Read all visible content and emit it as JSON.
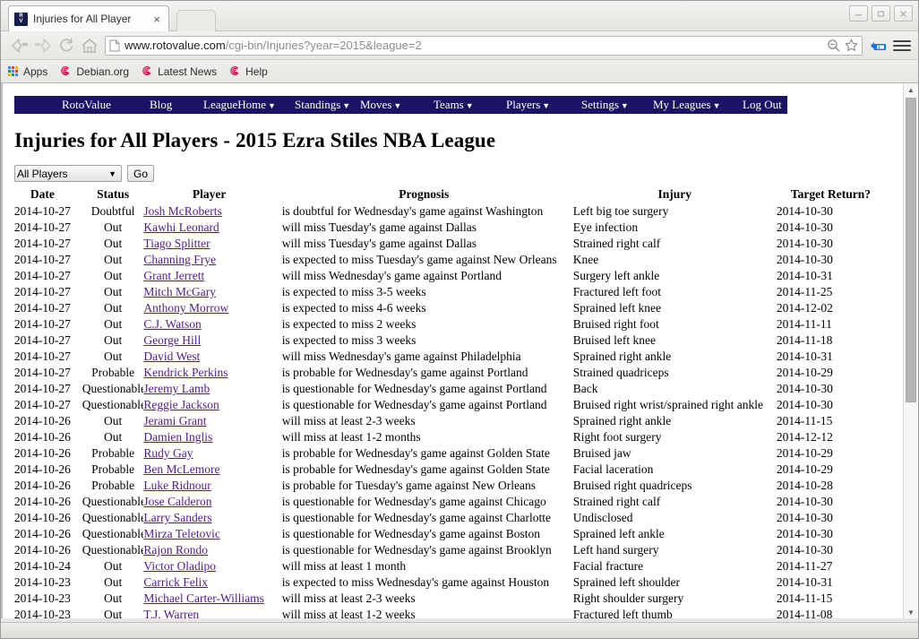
{
  "browser": {
    "tab": {
      "title": "Injuries for All Player",
      "favicon_text_top": "R",
      "favicon_text_bottom": "V",
      "close_label": "×"
    },
    "window_controls": {
      "minimize": "—",
      "maximize": "❐",
      "close": "✕"
    },
    "toolbar": {
      "back_icon": "back-arrow-icon",
      "forward_icon": "forward-arrow-icon",
      "reload_icon": "reload-icon",
      "home_icon": "home-icon",
      "url_host": "www.rotovalue.com",
      "url_path": "/cgi-bin/Injuries?year=2015&league=2",
      "search_icon": "search-icon",
      "bookmark_icon": "star-icon",
      "extension_icon": "extension-icon",
      "menu_icon": "hamburger-menu-icon"
    },
    "bookmarks": [
      {
        "label": "Apps",
        "icon": "apps-grid-icon"
      },
      {
        "label": "Debian.org",
        "icon": "debian-swirl-icon"
      },
      {
        "label": "Latest News",
        "icon": "debian-swirl-icon"
      },
      {
        "label": "Help",
        "icon": "debian-swirl-icon"
      }
    ]
  },
  "site": {
    "nav": [
      {
        "label": "RotoValue",
        "caret": ""
      },
      {
        "label": "Blog",
        "caret": ""
      },
      {
        "label": "LeagueHome",
        "caret": "▼"
      },
      {
        "label": "Standings",
        "caret": "▼"
      },
      {
        "label": "Moves",
        "caret": "▼"
      },
      {
        "label": "Teams",
        "caret": "▼"
      },
      {
        "label": "Players",
        "caret": "▼"
      },
      {
        "label": "Settings",
        "caret": "▼"
      },
      {
        "label": "My Leagues",
        "caret": "▼"
      },
      {
        "label": "Log Out",
        "caret": ""
      }
    ],
    "nav_background": "#1b1464",
    "page_title": "Injuries for All Players - 2015 Ezra Stiles NBA League",
    "filter": {
      "select_value": "All Players",
      "select_caret": "▼",
      "go_label": "Go"
    },
    "table": {
      "headers": [
        "Date",
        "Status",
        "Player",
        "Prognosis",
        "Injury",
        "Target Return?"
      ],
      "link_color": "#551a8b",
      "rows": [
        [
          "2014-10-27",
          "Doubtful",
          "Josh McRoberts",
          "is doubtful for Wednesday's game against Washington",
          "Left big toe surgery",
          "2014-10-30"
        ],
        [
          "2014-10-27",
          "Out",
          "Kawhi Leonard",
          "will miss Tuesday's game against Dallas",
          "Eye infection",
          "2014-10-30"
        ],
        [
          "2014-10-27",
          "Out",
          "Tiago Splitter",
          "will miss Tuesday's game against Dallas",
          "Strained right calf",
          "2014-10-30"
        ],
        [
          "2014-10-27",
          "Out",
          "Channing Frye",
          "is expected to miss Tuesday's game against New Orleans",
          "Knee",
          "2014-10-30"
        ],
        [
          "2014-10-27",
          "Out",
          "Grant Jerrett",
          "will miss Wednesday's game against Portland",
          "Surgery left ankle",
          "2014-10-31"
        ],
        [
          "2014-10-27",
          "Out",
          "Mitch McGary",
          "is expected to miss 3-5 weeks",
          "Fractured left foot",
          "2014-11-25"
        ],
        [
          "2014-10-27",
          "Out",
          "Anthony Morrow",
          "is expected to miss 4-6 weeks",
          "Sprained left knee",
          "2014-12-02"
        ],
        [
          "2014-10-27",
          "Out",
          "C.J. Watson",
          "is expected to miss 2 weeks",
          "Bruised right foot",
          "2014-11-11"
        ],
        [
          "2014-10-27",
          "Out",
          "George Hill",
          "is expected to miss 3 weeks",
          "Bruised left knee",
          "2014-11-18"
        ],
        [
          "2014-10-27",
          "Out",
          "David West",
          "will miss Wednesday's game against Philadelphia",
          "Sprained right ankle",
          "2014-10-31"
        ],
        [
          "2014-10-27",
          "Probable",
          "Kendrick Perkins",
          "is probable for Wednesday's game against Portland",
          "Strained quadriceps",
          "2014-10-29"
        ],
        [
          "2014-10-27",
          "Questionable",
          "Jeremy Lamb",
          "is questionable for Wednesday's game against Portland",
          "Back",
          "2014-10-30"
        ],
        [
          "2014-10-27",
          "Questionable",
          "Reggie Jackson",
          "is questionable for Wednesday's game against Portland",
          "Bruised right wrist/sprained right ankle",
          "2014-10-30"
        ],
        [
          "2014-10-26",
          "Out",
          "Jerami Grant",
          "will miss at least 2-3 weeks",
          "Sprained right ankle",
          "2014-11-15"
        ],
        [
          "2014-10-26",
          "Out",
          "Damien Inglis",
          "will miss at least 1-2 months",
          "Right foot surgery",
          "2014-12-12"
        ],
        [
          "2014-10-26",
          "Probable",
          "Rudy Gay",
          "is probable for Wednesday's game against Golden State",
          "Bruised jaw",
          "2014-10-29"
        ],
        [
          "2014-10-26",
          "Probable",
          "Ben McLemore",
          "is probable for Wednesday's game against Golden State",
          "Facial laceration",
          "2014-10-29"
        ],
        [
          "2014-10-26",
          "Probable",
          "Luke Ridnour",
          "is probable for Tuesday's game against New Orleans",
          "Bruised right quadriceps",
          "2014-10-28"
        ],
        [
          "2014-10-26",
          "Questionable",
          "Jose Calderon",
          "is questionable for Wednesday's game against Chicago",
          "Strained right calf",
          "2014-10-30"
        ],
        [
          "2014-10-26",
          "Questionable",
          "Larry Sanders",
          "is questionable for Wednesday's game against Charlotte",
          "Undisclosed",
          "2014-10-30"
        ],
        [
          "2014-10-26",
          "Questionable",
          "Mirza Teletovic",
          "is questionable for Wednesday's game against Boston",
          "Sprained left ankle",
          "2014-10-30"
        ],
        [
          "2014-10-26",
          "Questionable",
          "Rajon Rondo",
          "is questionable for Wednesday's game against Brooklyn",
          "Left hand surgery",
          "2014-10-30"
        ],
        [
          "2014-10-24",
          "Out",
          "Victor Oladipo",
          "will miss at least 1 month",
          "Facial fracture",
          "2014-11-27"
        ],
        [
          "2014-10-23",
          "Out",
          "Carrick Felix",
          "is expected to miss Wednesday's game against Houston",
          "Sprained left shoulder",
          "2014-10-31"
        ],
        [
          "2014-10-23",
          "Out",
          "Michael Carter-Williams",
          "will miss at least 2-3 weeks",
          "Right shoulder surgery",
          "2014-11-15"
        ],
        [
          "2014-10-23",
          "Out",
          "T.J. Warren",
          "will miss at least 1-2 weeks",
          "Fractured left thumb",
          "2014-11-08"
        ]
      ]
    }
  },
  "scrollbar": {
    "up_arrow": "▲",
    "down_arrow": "▼"
  }
}
